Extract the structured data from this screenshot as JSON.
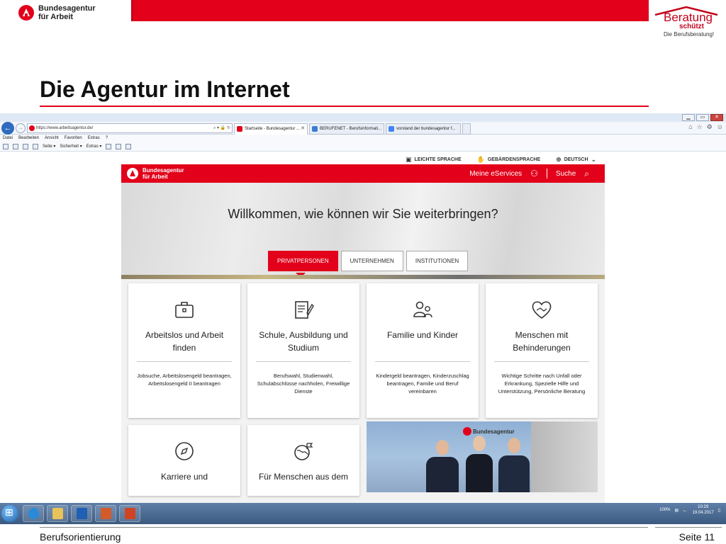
{
  "slide": {
    "brand_line1": "Bundesagentur",
    "brand_line2": "für Arbeit",
    "beratung_word": "Beratung",
    "beratung_sub": "schützt",
    "beratung_small": "Die Berufsberatung!",
    "title": "Die Agentur im Internet",
    "footer_left": "Berufsorientierung",
    "footer_right": "Seite 11"
  },
  "browser": {
    "url": "https://www.arbeitsagentur.de/",
    "tabs": [
      {
        "label": "Startseite - Bundesagentur ...",
        "color": "#e2001a"
      },
      {
        "label": "BERUFENET - Berufsinformati...",
        "color": "#3a7bd5"
      },
      {
        "label": "vorstand der bundesagentur f...",
        "color": "#4285f4"
      }
    ],
    "menu": [
      "Datei",
      "Bearbeiten",
      "Ansicht",
      "Favoriten",
      "Extras",
      "?"
    ],
    "commands": [
      "Seite ▾",
      "Sicherheit ▾",
      "Extras ▾"
    ]
  },
  "website": {
    "utility": [
      "LEICHTE SPRACHE",
      "GEBÄRDENSPRACHE",
      "DEUTSCH"
    ],
    "logo_line1": "Bundesagentur",
    "logo_line2": "für Arbeit",
    "nav_eservices": "Meine eServices",
    "nav_search": "Suche",
    "hero_title": "Willkommen, wie können wir Sie weiterbringen?",
    "hero_tabs": [
      "PRIVATPERSONEN",
      "UNTERNEHMEN",
      "INSTITUTIONEN"
    ],
    "cards": [
      {
        "title": "Arbeitslos und Arbeit finden",
        "desc": "Jobsuche, Arbeitslosengeld beantragen, Arbeitslosengeld II beantragen",
        "icon": "briefcase-icon"
      },
      {
        "title": "Schule, Ausbildung und Studium",
        "desc": "Berufswahl, Studienwahl, Schulabschlüsse nachholen, Freiwillige Dienste",
        "icon": "document-pen-icon"
      },
      {
        "title": "Familie und Kinder",
        "desc": "Kindergeld beantragen, Kinderzuschlag beantragen, Familie und Beruf vereinbaren",
        "icon": "family-icon"
      },
      {
        "title": "Menschen mit Behinderungen",
        "desc": "Wichtige Schritte nach Unfall oder Erkrankung, Spezielle Hilfe und Unterstützung, Persönliche Beratung",
        "icon": "heart-hands-icon"
      }
    ],
    "cards_row2": [
      {
        "title": "Karriere und",
        "icon": "compass-icon"
      },
      {
        "title": "Für Menschen aus dem",
        "icon": "globe-flag-icon"
      }
    ],
    "photo_brand": "Bundesagentur"
  },
  "taskbar": {
    "zoom": "100%",
    "time": "10:29",
    "date": "19.04.2017"
  },
  "colors": {
    "brand_red": "#e2001a",
    "taskbar": "#3c5a80"
  }
}
